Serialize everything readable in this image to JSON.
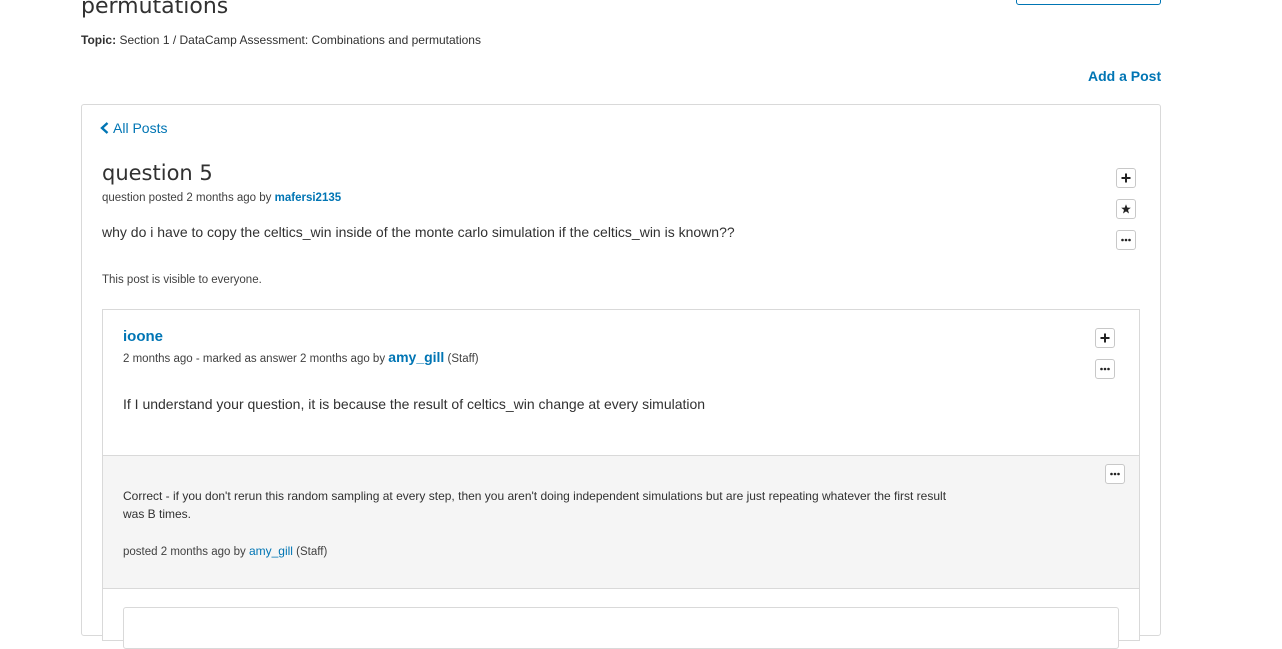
{
  "page": {
    "heading": "permutations",
    "topic_label": "Topic:",
    "topic_value": "Section 1 / DataCamp Assessment: Combinations and permutations",
    "add_post": "Add a Post"
  },
  "thread": {
    "back_label": "All Posts",
    "title": "question 5",
    "meta_prefix": "question posted 2 months ago by",
    "author": "mafersi2135",
    "body": "why do i have to copy the celtics_win inside of the monte carlo simulation if the celtics_win is known??",
    "visibility": "This post is visible to everyone."
  },
  "response": {
    "author": "ioone",
    "meta_prefix": "2 months ago - marked as answer 2 months ago by",
    "marked_by": "amy_gill",
    "marked_by_role": "(Staff)",
    "body": "If I understand your question, it is because the result of celtics_win change at every simulation"
  },
  "comment": {
    "body": "Correct - if you don't rerun this random sampling at every step, then you aren't doing independent simulations but are just repeating whatever the first result was B times.",
    "meta_prefix": "posted 2 months ago by",
    "author": "amy_gill",
    "role": "(Staff)"
  },
  "icons": {
    "back": "chevron-left-icon",
    "vote": "plus-icon",
    "follow": "star-icon",
    "more": "ellipsis-icon"
  },
  "colors": {
    "link": "#0075b4",
    "text": "#313131",
    "border": "#d9d9d9",
    "comment_bg": "#f5f5f5"
  }
}
